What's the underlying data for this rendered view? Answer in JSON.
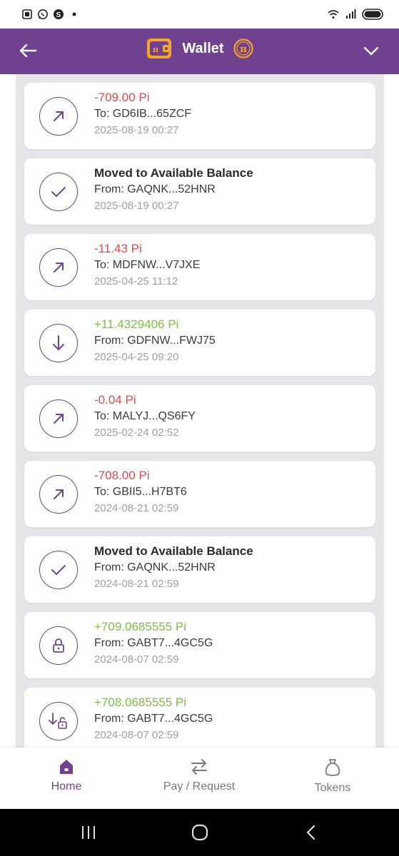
{
  "app": {
    "title": "Wallet",
    "accent_color": "#70418f",
    "negative_color": "#e04a4a",
    "positive_color": "#7bc043"
  },
  "status_bar": {
    "left_icons": [
      "screenshot-icon",
      "whatsapp-icon",
      "skype-icon",
      "dot-icon"
    ],
    "right_icons": [
      "wifi-icon",
      "signal-icon",
      "battery-icon"
    ]
  },
  "transactions": [
    {
      "title": "-709.00 Pi",
      "party": "To: GD6IB...65ZCF",
      "date": "2025-08-19 00:27",
      "kind": "neg",
      "icon": "arrow-up-right-icon"
    },
    {
      "title": "Moved to Available Balance",
      "party": "From: GAQNK...52HNR",
      "date": "2025-08-19 00:27",
      "kind": "neutral",
      "icon": "check-icon"
    },
    {
      "title": "-11.43 Pi",
      "party": "To: MDFNW...V7JXE",
      "date": "2025-04-25 11:12",
      "kind": "neg",
      "icon": "arrow-up-right-icon"
    },
    {
      "title": "+11.4329406 Pi",
      "party": "From: GDFNW...FWJ75",
      "date": "2025-04-25 09:20",
      "kind": "pos",
      "icon": "arrow-down-icon"
    },
    {
      "title": "-0.04 Pi",
      "party": "To: MALYJ...QS6FY",
      "date": "2025-02-24 02:52",
      "kind": "neg",
      "icon": "arrow-up-right-icon"
    },
    {
      "title": "-708.00 Pi",
      "party": "To: GBII5...H7BT6",
      "date": "2024-08-21 02:59",
      "kind": "neg",
      "icon": "arrow-up-right-icon"
    },
    {
      "title": "Moved to Available Balance",
      "party": "From: GAQNK...52HNR",
      "date": "2024-08-21 02:59",
      "kind": "neutral",
      "icon": "check-icon"
    },
    {
      "title": "+709.0685555 Pi",
      "party": "From: GABT7...4GC5G",
      "date": "2024-08-07 02:59",
      "kind": "pos",
      "icon": "lock-icon"
    },
    {
      "title": "+708.0685555 Pi",
      "party": "From: GABT7...4GC5G",
      "date": "2024-08-07 02:59",
      "kind": "pos",
      "icon": "unlock-download-icon"
    }
  ],
  "bottom_nav": {
    "home": "Home",
    "pay": "Pay / Request",
    "tokens": "Tokens"
  }
}
